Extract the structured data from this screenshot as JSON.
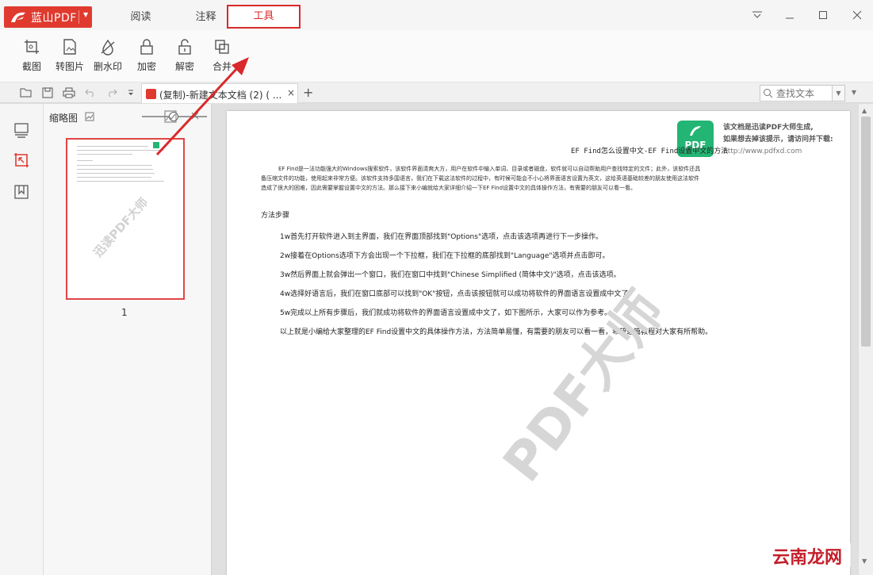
{
  "app": {
    "name": "蓝山PDF",
    "tabs": [
      {
        "label": "阅读"
      },
      {
        "label": "注释"
      },
      {
        "label": "工具"
      }
    ]
  },
  "window_controls": [
    "menu-icon",
    "minimize-icon",
    "maximize-icon",
    "close-icon"
  ],
  "toolbar": {
    "tools": [
      {
        "label": "截图",
        "icon": "screenshot-icon"
      },
      {
        "label": "转图片",
        "icon": "to-image-icon"
      },
      {
        "label": "删水印",
        "icon": "remove-watermark-icon"
      },
      {
        "label": "加密",
        "icon": "lock-icon"
      },
      {
        "label": "解密",
        "icon": "unlock-icon"
      },
      {
        "label": "合并",
        "icon": "merge-icon"
      }
    ]
  },
  "doc_tab": {
    "title": "(复制)-新建文本文档 (2) ( ...",
    "close": "×",
    "add": "+"
  },
  "search": {
    "placeholder": "查找文本"
  },
  "thumbnail_panel": {
    "title": "缩略图",
    "page_number": "1",
    "watermark": "迅读PDF大师"
  },
  "document": {
    "badge": "PDF",
    "notice_line1": "该文档是迅读PDF大师生成,",
    "notice_line2": "如果想去掉该提示，请访问并下载:",
    "notice_url": "http://www.pdfxd.com",
    "title": "EF Find怎么设置中文-EF Find设置中文的方法",
    "intro": "EF Find是一法功能强大的Windows搜索软件，该软件界面清爽大方，用户在软件中输入单词、目录或者磁盘，软件就可以自动帮助用户查找特定的文件；此外，该软件还具备压缩文件的功能，使用起来非常方便。该软件支持多国语言，我们在下载这法软件的过程中，有时候可能会不小心将界面语言设置为英文，这给英语基础较差的朋友使用这法软件造成了很大的困难，因此需要掌握设置中文的方法。那么接下来小编就给大家详细介绍一下EF Find设置中文的具体操作方法，有需要的朋友可以看一看。",
    "section": "方法步骤",
    "steps": [
      "1w首先打开软件进入到主界面，我们在界面顶部找到\"Options\"选项，点击该选项再进行下一步操作。",
      "2w接着在Options选项下方会出现一个下拉框，我们在下拉框的底部找到\"Language\"选项并点击即可。",
      "3w然后界面上就会弹出一个窗口，我们在窗口中找到\"Chinese Simplified (简体中文)\"选项，点击该选项。",
      "4w选择好语言后，我们在窗口底部可以找到\"OK\"按钮，点击该按钮就可以成功将软件的界面语言设置成中文了。",
      "5w完成以上所有步骤后，我们就成功将软件的界面语言设置成中文了，如下图所示，大家可以作为参考。",
      "以上就是小编给大家整理的EF Find设置中文的具体操作方法，方法简单易懂，有需要的朋友可以看一看，希望这篇教程对大家有所帮助。"
    ],
    "watermark": "PDF大师"
  },
  "site_watermark": "云南龙网",
  "colors": {
    "brand": "#e03a2f",
    "highlight": "#d9292b",
    "badge": "#22b573"
  }
}
